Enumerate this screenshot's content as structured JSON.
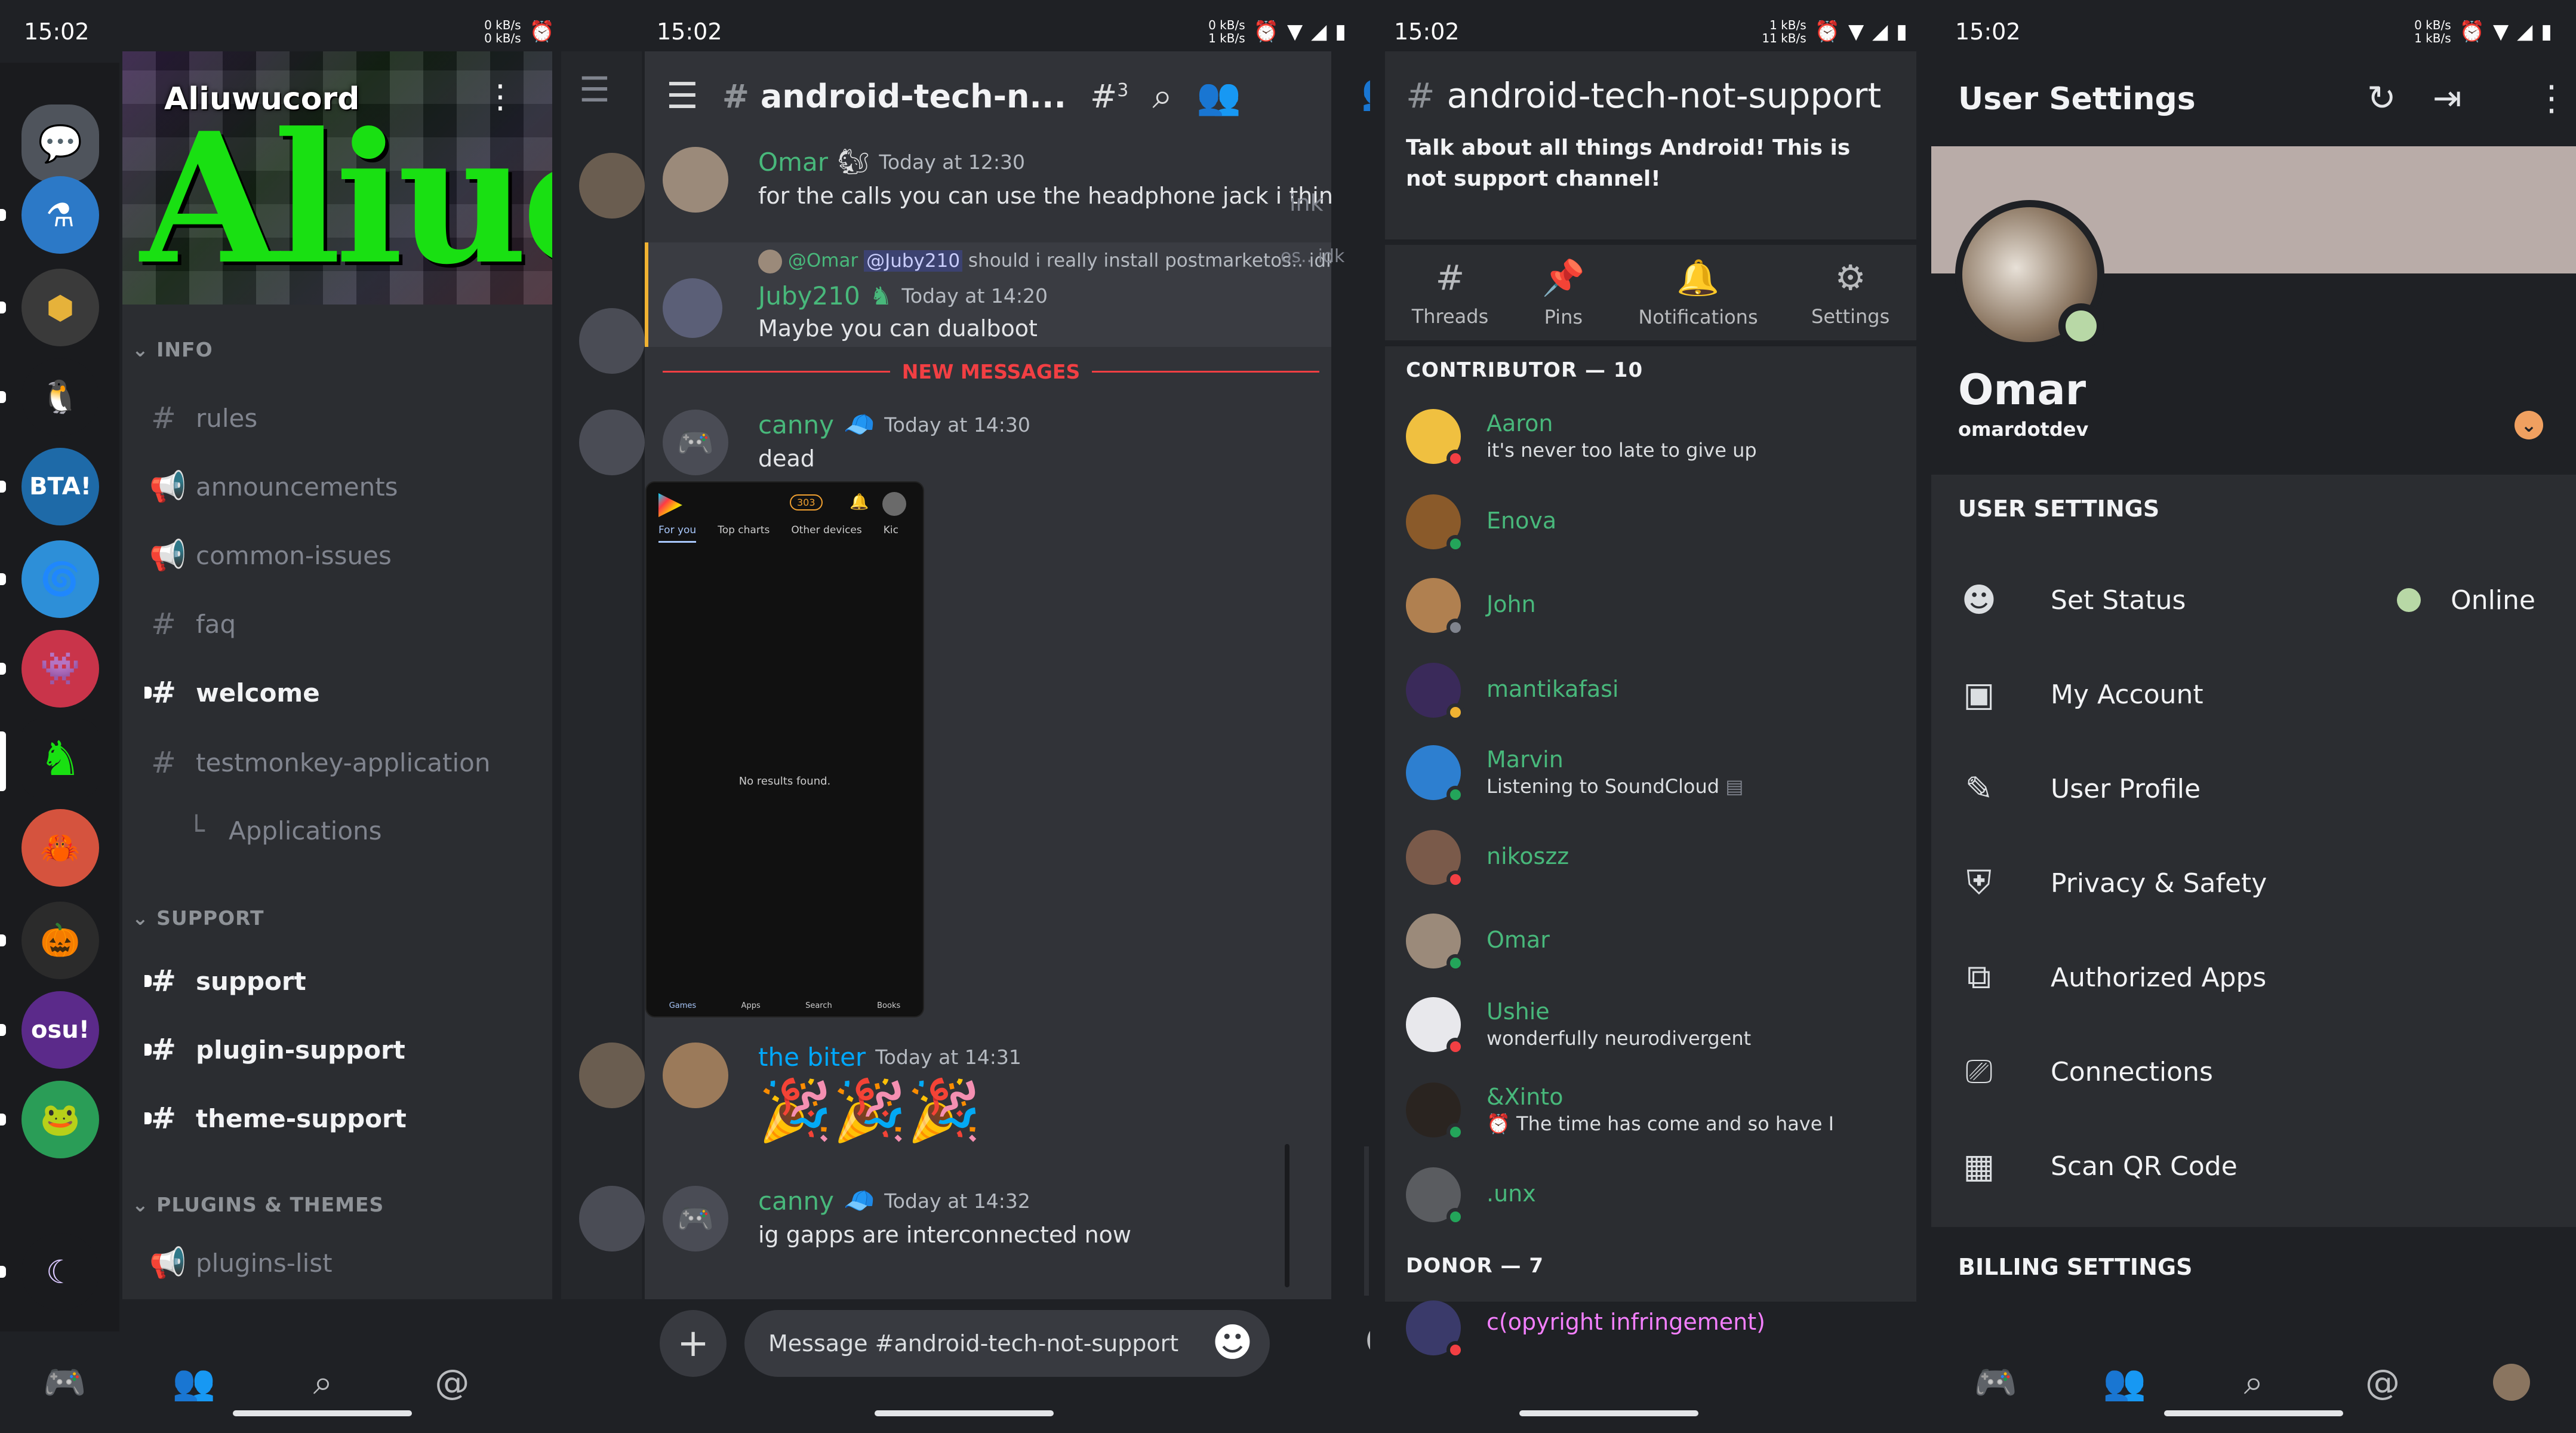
{
  "status": {
    "time": "15:02"
  },
  "panel1": {
    "speed": [
      "0 kB/s",
      "0 kB/s"
    ],
    "server_name": "Aliuwucord",
    "server_banner_text": "Aliucord",
    "categories": {
      "info": "INFO",
      "support": "SUPPORT",
      "plugins": "PLUGINS & THEMES"
    },
    "channels": {
      "rules": "rules",
      "announcements": "announcements",
      "common_issues": "common-issues",
      "faq": "faq",
      "welcome": "welcome",
      "testmonkey": "testmonkey-application",
      "applications": "Applications",
      "support": "support",
      "plugin_support": "plugin-support",
      "theme_support": "theme-support",
      "plugins_list": "plugins-list"
    },
    "guild_labels": {
      "bta": "BTA!",
      "osu": "osu!"
    }
  },
  "panel2": {
    "speed": [
      "0 kB/s",
      "1 kB/s"
    ],
    "title": "android-tech-n...",
    "thread_count": "3",
    "messages": [
      {
        "author": "Omar",
        "time": "Today at 12:30",
        "text": "for the calls you can use the headphone jack i think",
        "color": "#48b87b"
      },
      {
        "reply_author": "@Omar",
        "reply_mention": "@Juby210",
        "reply_text": "should i really install postmarketos.. idk",
        "author": "Juby210",
        "time": "Today at 14:20",
        "text": "Maybe you can dualboot",
        "color": "#48b87b"
      },
      {
        "author": "canny",
        "time": "Today at 14:30",
        "text": "dead",
        "color": "#48b87b"
      },
      {
        "author": "the biter",
        "time": "Today at 14:31",
        "text": "🎉🎉🎉",
        "color": "#00a8fc"
      },
      {
        "author": "canny",
        "time": "Today at 14:32",
        "text": "ig gapps are interconnected now",
        "color": "#48b87b"
      }
    ],
    "new_messages": "NEW MESSAGES",
    "side_peek_1": "ink",
    "side_peek_2": "os.. idk",
    "phone_shot": {
      "badge": "303",
      "tabs": [
        "For you",
        "Top charts",
        "Other devices",
        "Kic"
      ],
      "empty": "No results found.",
      "bottom": [
        "Games",
        "Apps",
        "Search",
        "Books"
      ]
    },
    "input_placeholder": "Message #android-tech-not-support"
  },
  "panel3": {
    "speed": [
      "1 kB/s",
      "11 kB/s"
    ],
    "channel_name": "android-tech-not-support",
    "topic": "Talk about all things Android! This is not support channel!",
    "actions": [
      "Threads",
      "Pins",
      "Notifications",
      "Settings"
    ],
    "roles": {
      "contributor": "CONTRIBUTOR — 10",
      "donor": "DONOR — 7"
    },
    "members": [
      {
        "name": "Aaron",
        "sub": "it's never too late to give up",
        "status": "#f23f43"
      },
      {
        "name": "Enova",
        "sub": "",
        "status": "#23a55a"
      },
      {
        "name": "John",
        "sub": "",
        "status": "#80848e"
      },
      {
        "name": "mantikafasi",
        "sub": "",
        "status": "#f0b232"
      },
      {
        "name": "Marvin",
        "sub": "Listening to SoundCloud",
        "status": "#23a55a"
      },
      {
        "name": "nikoszz",
        "sub": "",
        "status": "#f23f43"
      },
      {
        "name": "Omar",
        "sub": "",
        "status": "#23a55a"
      },
      {
        "name": "Ushie",
        "sub": "wonderfully neurodivergent",
        "status": "#f23f43"
      },
      {
        "name": "&Xinto",
        "sub": "⏰ The time has come and so have I",
        "status": "#23a55a"
      },
      {
        "name": ".unx",
        "sub": "",
        "status": "#23a55a"
      }
    ],
    "donor_members": [
      {
        "name": "c(opyright infringement)",
        "status": "#f23f43"
      }
    ]
  },
  "panel4": {
    "speed": [
      "0 kB/s",
      "1 kB/s"
    ],
    "title": "User Settings",
    "display_name": "Omar",
    "username": "omardotdev",
    "section_user": "USER SETTINGS",
    "section_billing": "BILLING SETTINGS",
    "rows": [
      {
        "label": "Set Status",
        "value": "Online"
      },
      {
        "label": "My Account"
      },
      {
        "label": "User Profile"
      },
      {
        "label": "Privacy & Safety"
      },
      {
        "label": "Authorized Apps"
      },
      {
        "label": "Connections"
      },
      {
        "label": "Scan QR Code"
      }
    ]
  },
  "colors": {
    "green": "#48b87b",
    "red": "#f23f43",
    "online": "#b8d8a6",
    "blurple": "#5865f2"
  },
  "icons": [
    "chat-icon",
    "hamburger-icon",
    "threads-icon",
    "search-icon",
    "members-icon",
    "pin-icon",
    "bell-icon",
    "gear-icon",
    "refresh-icon",
    "logout-icon",
    "more-icon",
    "discord-icon",
    "friends-icon",
    "mention-icon",
    "plus-icon",
    "emoji-icon"
  ]
}
